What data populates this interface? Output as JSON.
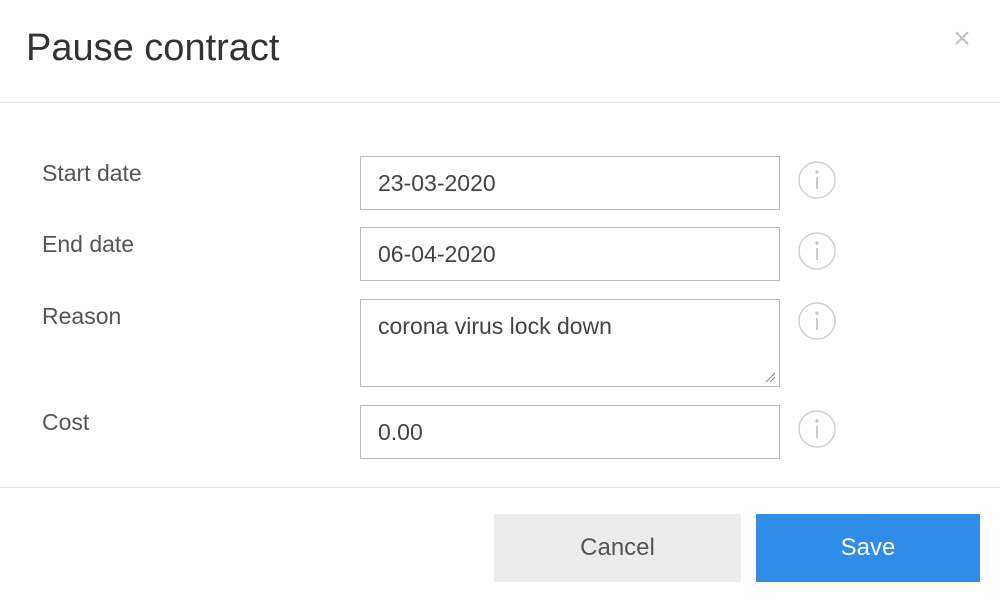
{
  "dialog": {
    "title": "Pause contract",
    "close_glyph": "×"
  },
  "form": {
    "start_date": {
      "label": "Start date",
      "value": "23-03-2020",
      "info_icon": "info-icon"
    },
    "end_date": {
      "label": "End date",
      "value": "06-04-2020",
      "info_icon": "info-icon"
    },
    "reason": {
      "label": "Reason",
      "value": "corona virus lock down",
      "info_icon": "info-icon"
    },
    "cost": {
      "label": "Cost",
      "value": "0.00",
      "info_icon": "info-icon"
    }
  },
  "footer": {
    "cancel_label": "Cancel",
    "save_label": "Save"
  },
  "colors": {
    "primary": "#2f8ce8",
    "secondary_button": "#ececec",
    "border": "#bdbdbd"
  }
}
